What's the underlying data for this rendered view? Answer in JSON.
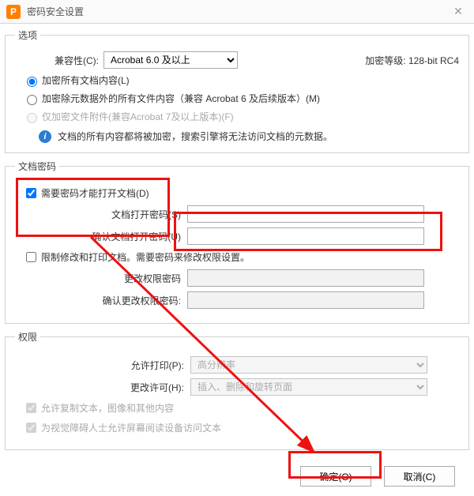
{
  "window": {
    "title": "密码安全设置",
    "logo_letter": "P"
  },
  "options": {
    "legend": "选项",
    "compat_label": "兼容性(C):",
    "compat_value": "Acrobat 6.0 及以上",
    "enc_level_label": "加密等级:",
    "enc_level_value": "128-bit RC4",
    "radio1": "加密所有文档内容(L)",
    "radio2": "加密除元数据外的所有文件内容（兼容 Acrobat 6 及后续版本）(M)",
    "radio3": "仅加密文件附件(兼容Acrobat 7及以上版本)(F)",
    "info_text": "文档的所有内容都将被加密，搜索引擎将无法访问文档的元数据。"
  },
  "doc_pw": {
    "legend": "文档密码",
    "require_pw": "需要密码才能打开文档(D)",
    "open_pw_label": "文档打开密码(S)",
    "confirm_open_pw_label": "确认文档打开密码(U)",
    "restrict_edit": "限制修改和打印文档。需要密码来修改权限设置。",
    "perm_pw_label": "更改权限密码",
    "confirm_perm_pw_label": "确认更改权限密码:"
  },
  "perm": {
    "legend": "权限",
    "print_label": "允许打印(P):",
    "print_value": "高分辨率",
    "change_label": "更改许可(H):",
    "change_value": "插入、删除和旋转页面",
    "allow_copy": "允许复制文本，图像和其他内容",
    "allow_screenreader": "为视觉障碍人士允许屏幕阅读设备访问文本"
  },
  "buttons": {
    "ok": "确定(O)",
    "cancel": "取消(C)"
  }
}
